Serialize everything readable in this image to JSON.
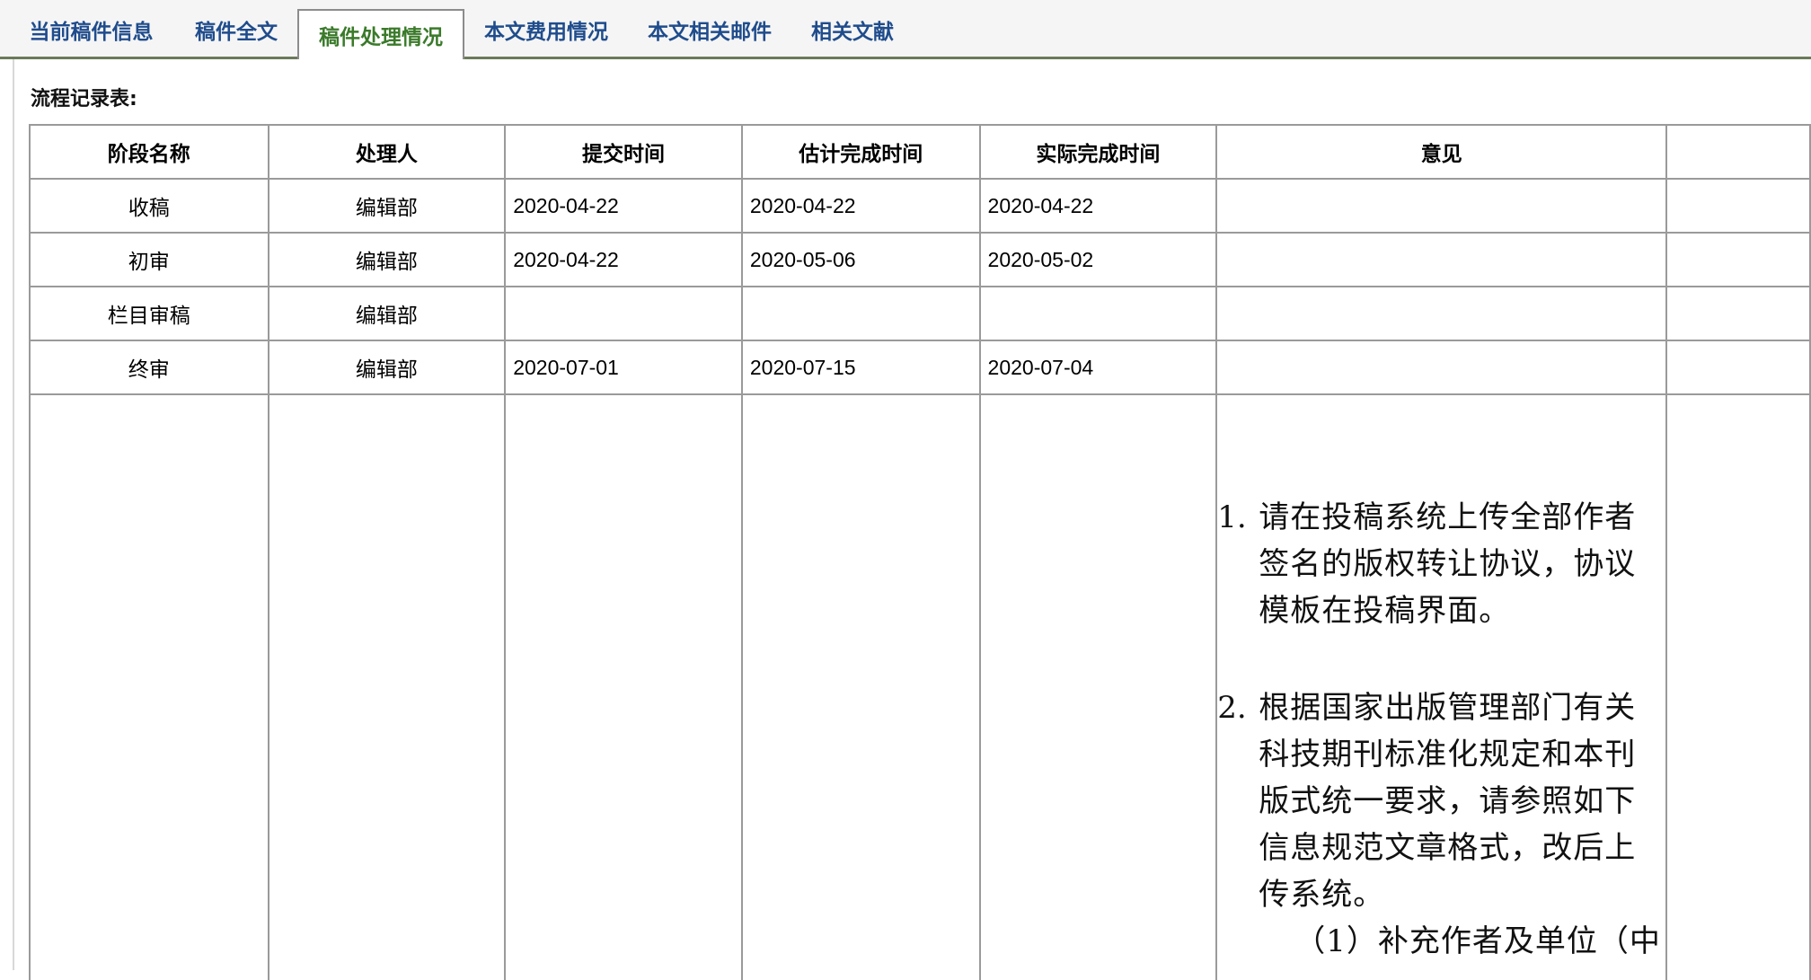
{
  "tabs": [
    {
      "label": "当前稿件信息"
    },
    {
      "label": "稿件全文"
    },
    {
      "label": "稿件处理情况",
      "active": true
    },
    {
      "label": "本文费用情况"
    },
    {
      "label": "本文相关邮件"
    },
    {
      "label": "相关文献"
    }
  ],
  "section_title": "流程记录表:",
  "table": {
    "headers": [
      "阶段名称",
      "处理人",
      "提交时间",
      "估计完成时间",
      "实际完成时间",
      "意见",
      ""
    ],
    "rows": [
      {
        "stage": "收稿",
        "handler": "编辑部",
        "submitted": "2020-04-22",
        "estimated": "2020-04-22",
        "actual": "2020-04-22",
        "opinion": ""
      },
      {
        "stage": "初审",
        "handler": "编辑部",
        "submitted": "2020-04-22",
        "estimated": "2020-05-06",
        "actual": "2020-05-02",
        "opinion": ""
      },
      {
        "stage": "栏目审稿",
        "handler": "编辑部",
        "submitted": "",
        "estimated": "",
        "actual": "",
        "opinion": ""
      },
      {
        "stage": "终审",
        "handler": "编辑部",
        "submitted": "2020-07-01",
        "estimated": "2020-07-15",
        "actual": "2020-07-04",
        "opinion": ""
      }
    ],
    "opinion_items": [
      {
        "num": "1.",
        "text": "请在投稿系统上传全部作者签名的版权转让协议，协议模板在投稿界面。"
      },
      {
        "num": "2.",
        "text": "根据国家出版管理部门有关科技期刊标准化规定和本刊版式统一要求，请参照如下信息规范文章格式，改后上传系统。"
      }
    ],
    "opinion_sub": "（1）补充作者及单位（中"
  },
  "colors": {
    "tab_text": "#1f4c8c",
    "tab_active_text": "#3a7a2a",
    "tabbar_border": "#6a7a5a",
    "grid": "#9a9a9a"
  }
}
